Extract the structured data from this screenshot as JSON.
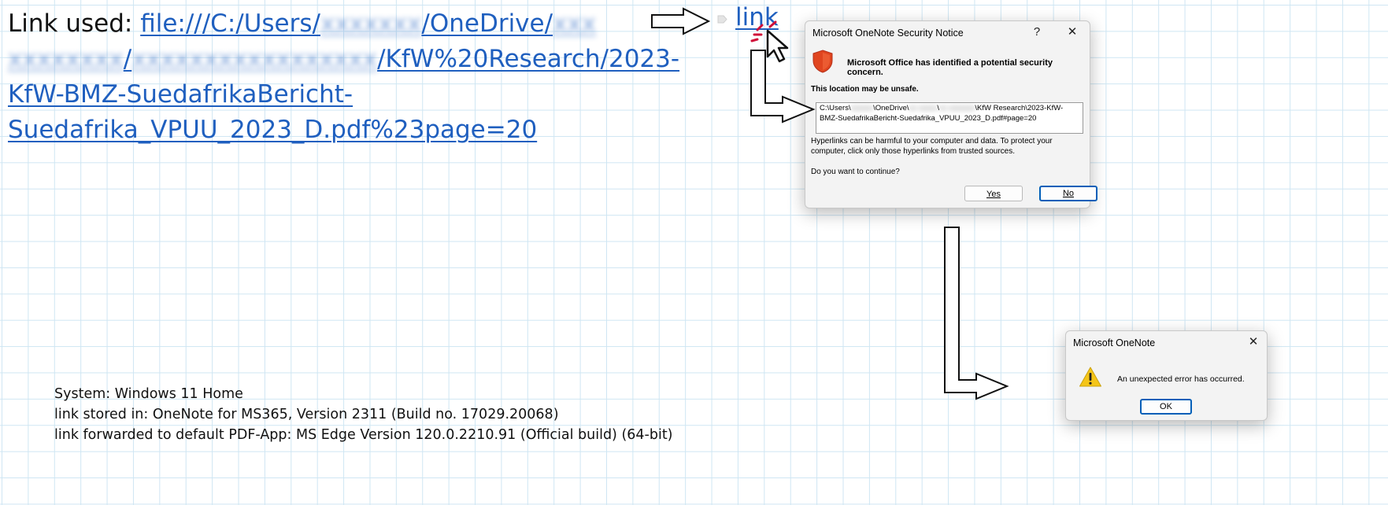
{
  "note": {
    "prefix": "Link used: ",
    "link_seg1": "file:///C:/Users/",
    "link_blur1": "xxxxxxx",
    "link_seg2": "/OneDrive/",
    "link_blur2": "xxx",
    "link_blur3": "xxxxxxxx",
    "link_seg3": "/",
    "link_blur4": "xxxxxxxxxxxxxxxxx",
    "link_seg4": "/KfW%20Research/2023-KfW-BMZ-SuedafrikaBericht-Suedafrika_VPUU_2023_D.pdf%23page=20",
    "link_label": "link"
  },
  "security_dialog": {
    "title": "Microsoft OneNote Security Notice",
    "help": "?",
    "close": "✕",
    "headline": "Microsoft Office has identified a potential security concern.",
    "warning": "This location may be unsafe.",
    "path_a": "C:\\Users\\",
    "path_blur_a": "xxxxxx",
    "path_b": "\\OneDrive\\",
    "path_blur_b": "xx xxxxx",
    "path_c": "\\",
    "path_blur_c": "xx xxxxxxx",
    "path_d": "\\KfW Research\\2023-KfW-BMZ-SuedafrikaBericht-Suedafrika_VPUU_2023_D.pdf#page=20",
    "body": "Hyperlinks can be harmful to your computer and data. To protect your computer, click only those hyperlinks from trusted sources.",
    "question": "Do you want to continue?",
    "yes": "Yes",
    "no": "No"
  },
  "error_dialog": {
    "title": "Microsoft OneNote",
    "close": "✕",
    "message": "An unexpected error has occurred.",
    "ok": "OK"
  },
  "system_info": {
    "line1": "System: Windows 11 Home",
    "line2": "link stored in: OneNote for MS365, Version 2311 (Build no. 17029.20068)",
    "line3": "link forwarded to default PDF-App: MS Edge Version 120.0.2210.91 (Official build) (64-bit)"
  },
  "colors": {
    "link": "#1f5fbf",
    "grid": "#cfe6f3",
    "shield": "#e0451f",
    "warning": "#f5c518",
    "click_burst": "#d0103a"
  },
  "icons": [
    "shield-icon",
    "warning-icon",
    "mouse-cursor-icon",
    "click-burst-icon",
    "arrow-icon"
  ]
}
